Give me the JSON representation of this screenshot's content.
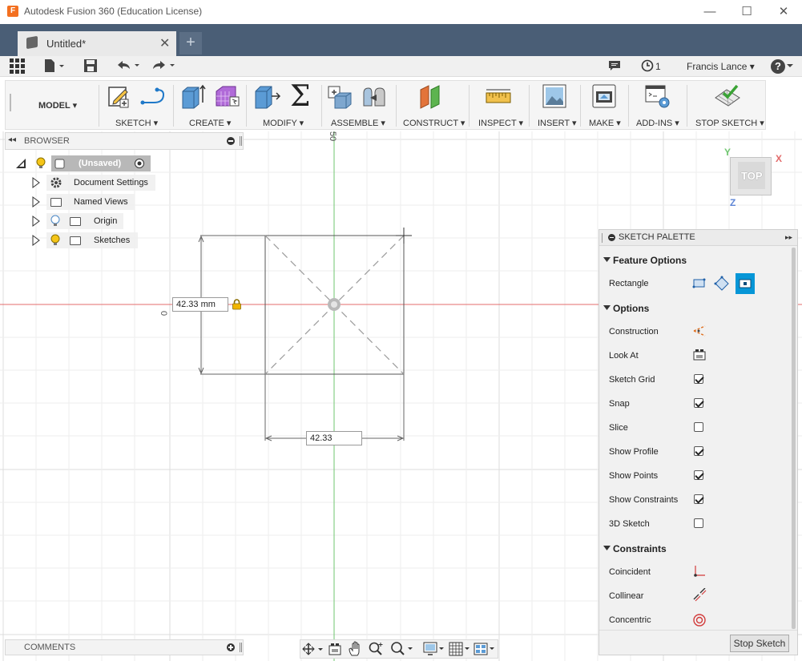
{
  "window": {
    "title": "Autodesk Fusion 360 (Education License)",
    "logo_letter": "F",
    "controls": {
      "minimize": "—",
      "maximize": "☐",
      "close": "✕"
    }
  },
  "tabs": {
    "doc_tab_label": "Untitled*",
    "close_glyph": "✕",
    "new_tab_glyph": "+"
  },
  "quick_access": {
    "job_count": "1",
    "user_name": "Francis Lance ▾",
    "help_glyph": "?"
  },
  "ribbon": {
    "workspace": "MODEL ▾",
    "groups": [
      "SKETCH ▾",
      "CREATE ▾",
      "MODIFY ▾",
      "ASSEMBLE ▾",
      "CONSTRUCT ▾",
      "INSPECT ▾",
      "INSERT ▾",
      "MAKE ▾",
      "ADD-INS ▾",
      "STOP SKETCH ▾"
    ],
    "modify_symbol": "Σ"
  },
  "browser": {
    "title": "BROWSER",
    "collapse_glyph": "◂◂",
    "items": [
      {
        "label": "(Unsaved)"
      },
      {
        "label": "Document Settings"
      },
      {
        "label": "Named Views"
      },
      {
        "label": "Origin"
      },
      {
        "label": "Sketches"
      }
    ]
  },
  "canvas": {
    "dim_vertical": "42.33 mm",
    "dim_horizontal": "42.33",
    "axis_label_top": "50",
    "axis_label_left": "0",
    "viewcube_label": "TOP",
    "axis_x": "X",
    "axis_y": "Y",
    "axis_z": "Z"
  },
  "palette": {
    "title": "SKETCH PALETTE",
    "expand_glyph": "▸▸",
    "sections": {
      "feature_options": "Feature Options",
      "options": "Options",
      "constraints": "Constraints"
    },
    "rectangle_label": "Rectangle",
    "options": [
      {
        "label": "Construction"
      },
      {
        "label": "Look At"
      },
      {
        "label": "Sketch Grid",
        "checked": true
      },
      {
        "label": "Snap",
        "checked": true
      },
      {
        "label": "Slice",
        "checked": false
      },
      {
        "label": "Show Profile",
        "checked": true
      },
      {
        "label": "Show Points",
        "checked": true
      },
      {
        "label": "Show Constraints",
        "checked": true
      },
      {
        "label": "3D Sketch",
        "checked": false
      }
    ],
    "constraints": [
      {
        "label": "Coincident"
      },
      {
        "label": "Collinear"
      },
      {
        "label": "Concentric"
      }
    ],
    "stop_button": "Stop Sketch"
  },
  "comments": {
    "title": "COMMENTS"
  },
  "colors": {
    "tabbar": "#4a5e76",
    "accent_blue": "#0696d7",
    "x_axis_red": "#e05050",
    "y_axis_green": "#5cbf5c",
    "bulb_yellow": "#f5c518"
  }
}
